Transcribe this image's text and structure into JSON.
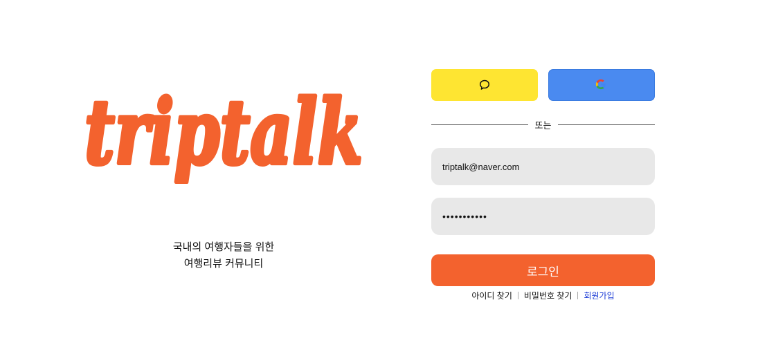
{
  "brand": {
    "logo_text": "triptalk",
    "tagline_line1": "국내의 여행자들을 위한",
    "tagline_line2": "여행리뷰 커뮤니티"
  },
  "colors": {
    "brand_orange": "#f3622e",
    "kakao_yellow": "#fee532",
    "google_blue": "#4a8af0",
    "input_bg": "#e8e8e8",
    "signup_link": "#1a3ad6"
  },
  "social": {
    "kakao_icon": "speech-bubble-icon",
    "google_icon": "google-icon"
  },
  "divider": {
    "label": "또는"
  },
  "form": {
    "email_value": "triptalk@naver.com",
    "password_value": "•••••••••••",
    "login_label": "로그인"
  },
  "links": {
    "find_id": "아이디 찾기",
    "find_password": "비밀번호 찾기",
    "signup": "회원가입"
  }
}
